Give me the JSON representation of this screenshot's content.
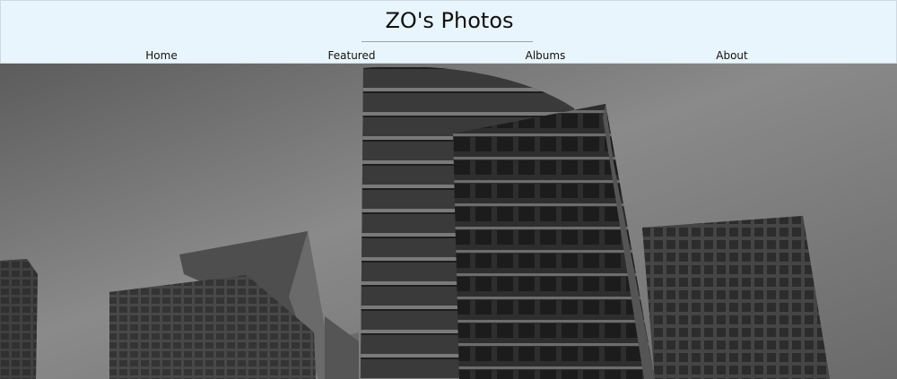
{
  "header": {
    "title": "ZO's Photos",
    "background": "#e9f5fd"
  },
  "nav": {
    "items": [
      {
        "label": "Home"
      },
      {
        "label": "Featured"
      },
      {
        "label": "Albums"
      },
      {
        "label": "About"
      }
    ]
  },
  "hero": {
    "style": "black-and-white",
    "subject": "office-towers"
  }
}
